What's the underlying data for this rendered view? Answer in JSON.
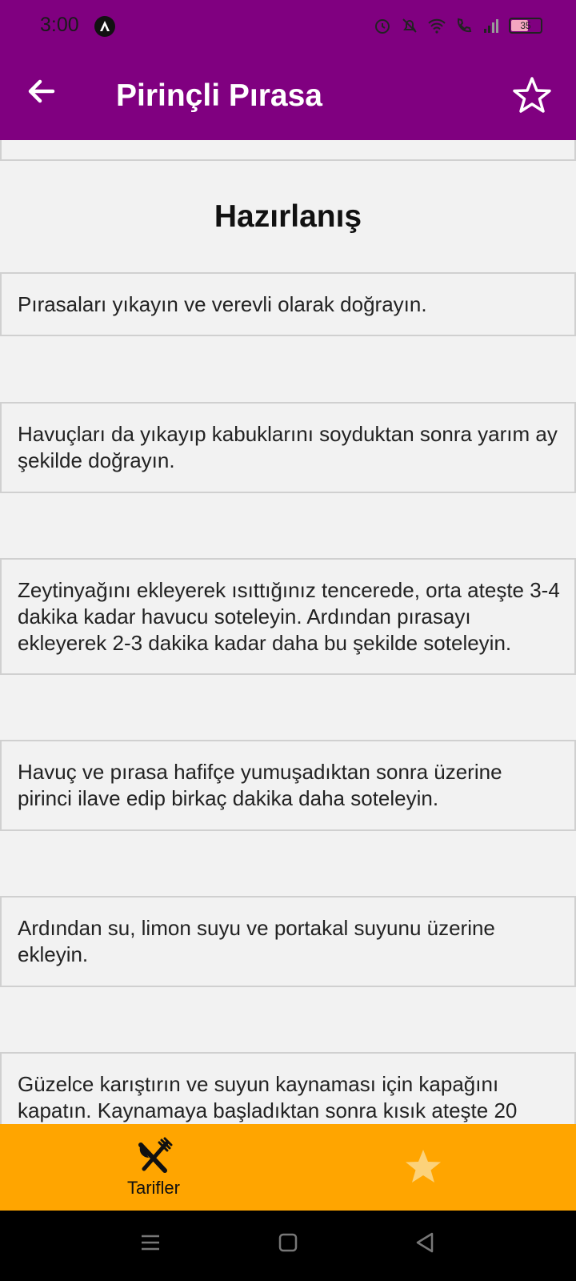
{
  "status_bar": {
    "time": "3:00",
    "battery": "35"
  },
  "app_bar": {
    "title": "Pirinçli Pırasa"
  },
  "section": {
    "title": "Hazırlanış"
  },
  "steps": [
    "Pırasaları yıkayın ve verevli olarak doğrayın.",
    "Havuçları da yıkayıp kabuklarını soyduktan sonra yarım ay şekilde doğrayın.",
    "Zeytinyağını ekleyerek ısıttığınız tencerede, orta ateşte 3-4 dakika kadar havucu soteleyin. Ardından pırasayı ekleyerek 2-3 dakika kadar daha bu şekilde soteleyin.",
    "Havuç ve pırasa hafifçe yumuşadıktan sonra üzerine pirinci ilave edip birkaç dakika daha soteleyin.",
    "Ardından su, limon suyu ve portakal suyunu üzerine ekleyin.",
    "Güzelce karıştırın ve suyun kaynaması için kapağını kapatın. Kaynamaya başladıktan sonra kısık ateşte 20"
  ],
  "bottom_nav": {
    "recipes_label": "Tarifler"
  },
  "colors": {
    "app_bar": "#800080",
    "bottom_nav": "#ffa500",
    "favorite_star": "#fcd27a"
  }
}
